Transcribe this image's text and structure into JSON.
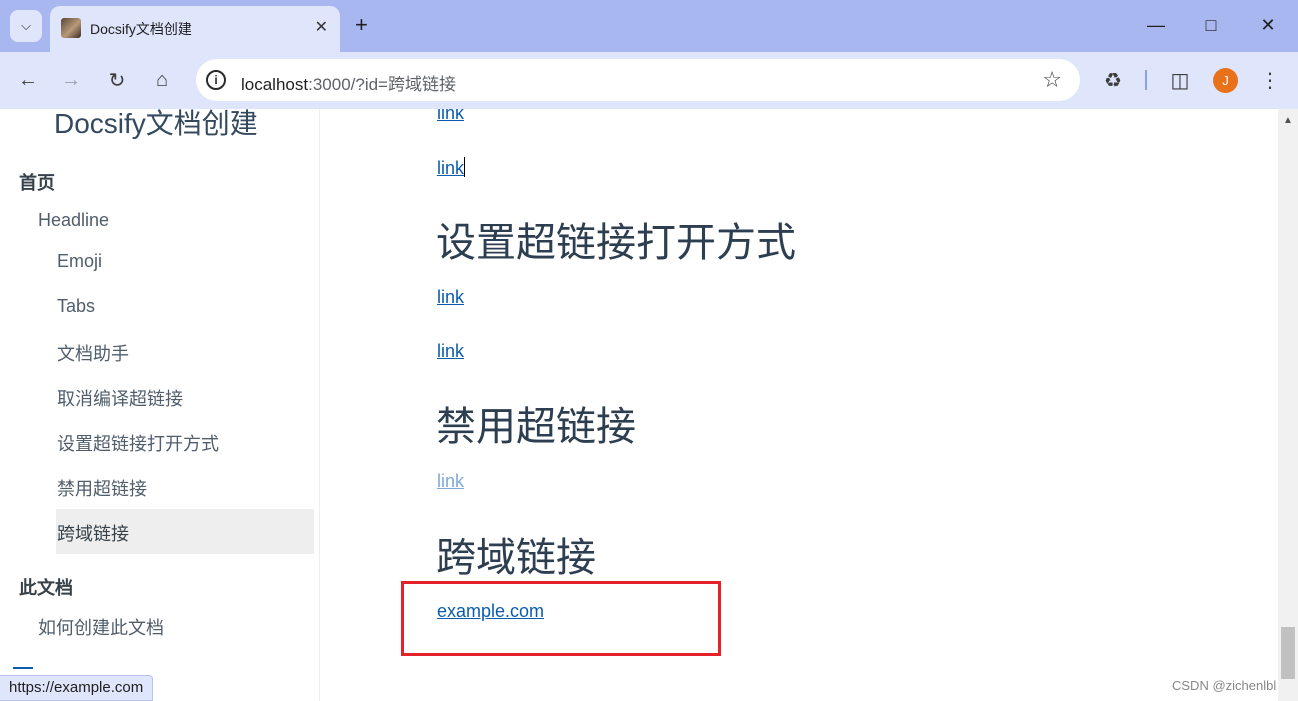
{
  "browser": {
    "tab_title": "Docsify文档创建",
    "url_host": "localhost",
    "url_rest": ":3000/?id=跨域链接",
    "avatar_letter": "J",
    "status_url": "https://example.com"
  },
  "sidebar": {
    "app_name": "Docsify文档创建",
    "section1": "首页",
    "headline": "Headline",
    "items": [
      "Emoji",
      "Tabs",
      "文档助手",
      "取消编译超链接",
      "设置超链接打开方式",
      "禁用超链接",
      "跨域链接"
    ],
    "section2": "此文档",
    "section2_items": [
      "如何创建此文档"
    ]
  },
  "content": {
    "link_top": "link",
    "link_caret": "link",
    "heading_open_mode": "设置超链接打开方式",
    "link_open_1": "link",
    "link_open_2": "link",
    "heading_disable": "禁用超链接",
    "link_disabled": "link",
    "heading_cross": "跨域链接",
    "link_example": "example.com"
  },
  "watermark": "CSDN @zichenlbl"
}
